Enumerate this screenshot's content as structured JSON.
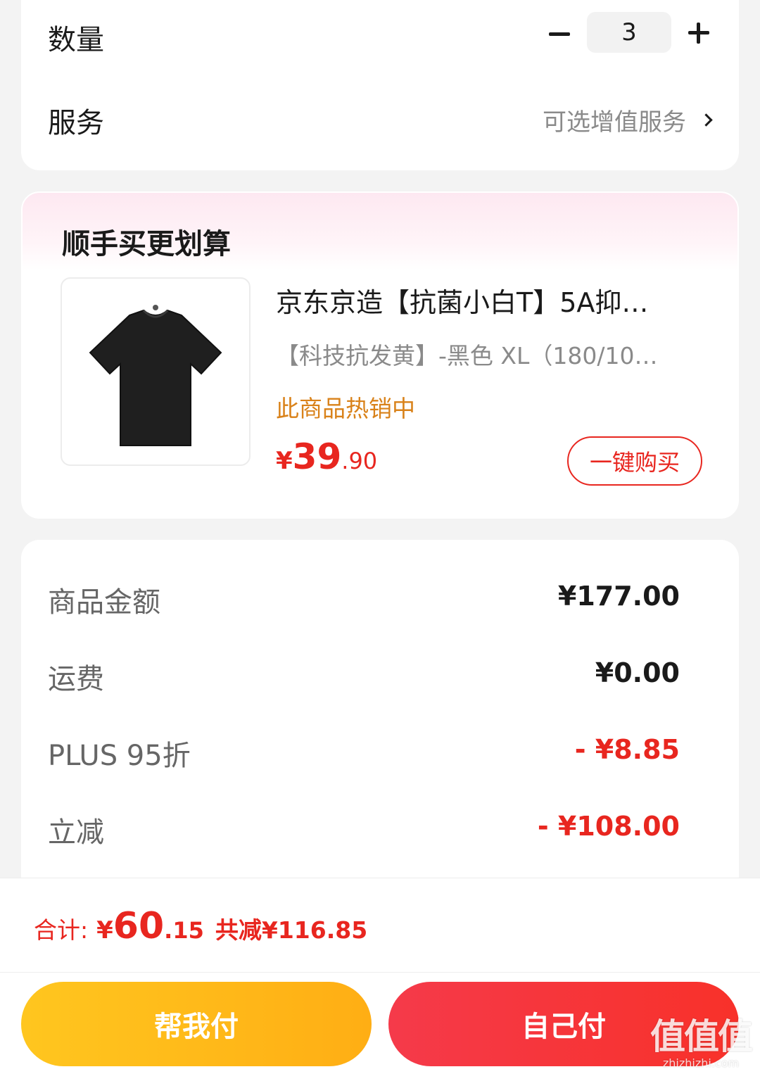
{
  "top_card": {
    "quantity_label": "数量",
    "quantity_value": "3",
    "service_label": "服务",
    "service_value": "可选增值服务"
  },
  "recommend": {
    "title": "顺手买更划算",
    "product": {
      "image_icon": "black-tshirt",
      "title": "京东京造【抗菌小白T】5A抑…",
      "spec": "【科技抗发黄】-黑色   XL（180/10…",
      "hot": "此商品热销中",
      "price_currency": "¥",
      "price_int": "39",
      "price_dec": ".90",
      "buy_label": "一键购买"
    }
  },
  "summary": {
    "rows": [
      {
        "label": "商品金额",
        "value": "¥177.00"
      },
      {
        "label": "运费",
        "value": "¥0.00"
      },
      {
        "label": "PLUS 95折",
        "value": "- ¥8.85"
      },
      {
        "label": "立减",
        "value": "- ¥108.00"
      }
    ]
  },
  "bottom": {
    "total_label": "合计:",
    "total_currency": "¥",
    "total_int": "60",
    "total_dec": ".15",
    "save_text": "共减¥116.85",
    "help_pay_label": "帮我付",
    "self_pay_label": "自己付",
    "watermark_logo": "值值值",
    "watermark_url": "zhizhizhi.com"
  },
  "colors": {
    "accent_red": "#e8261f",
    "hot_orange": "#d9821a",
    "help_btn": "#ffb818",
    "self_btn": "#f53a3a"
  }
}
